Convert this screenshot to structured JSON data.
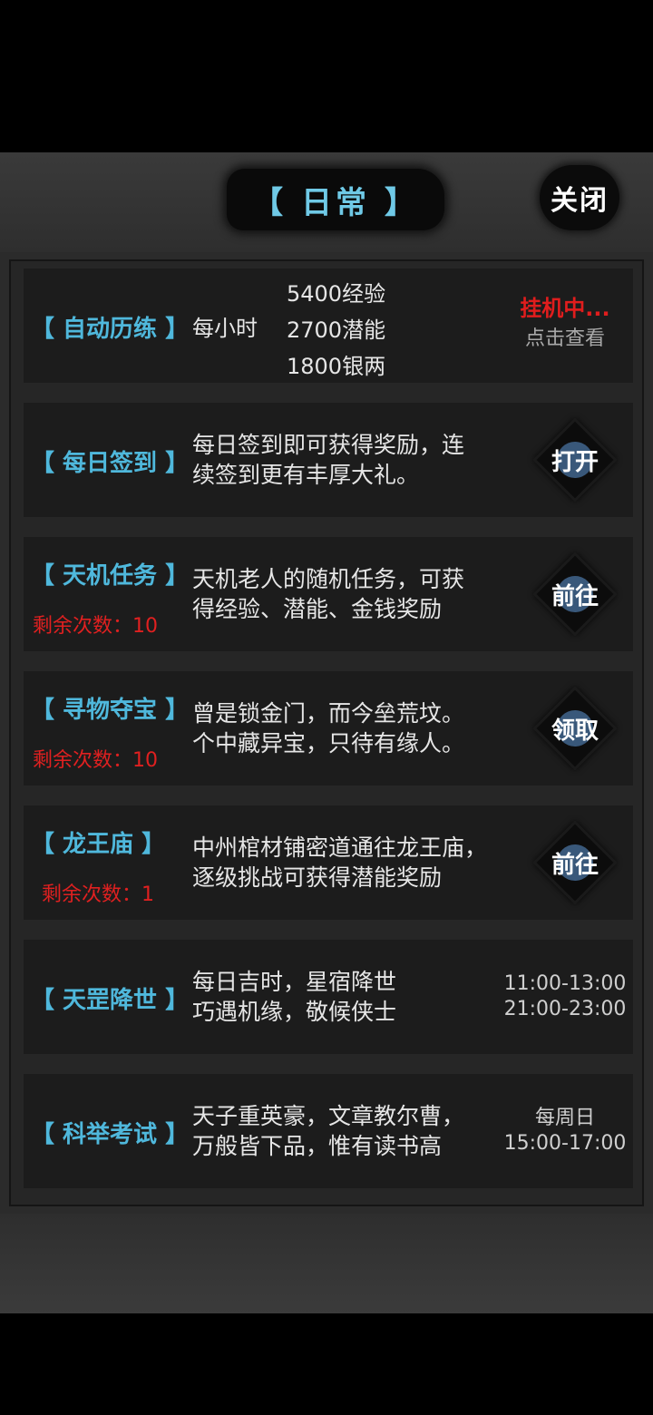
{
  "header": {
    "title": "【 日常 】",
    "close_label": "关闭"
  },
  "rows": [
    {
      "name": "【 自动历练 】",
      "per_label": "每小时",
      "stats": [
        "5400经验",
        "2700潜能",
        "1800银两"
      ],
      "status": "挂机中...",
      "status_action": "点击查看"
    },
    {
      "name": "【 每日签到 】",
      "desc_lines": [
        "每日签到即可获得奖励，连",
        "续签到更有丰厚大礼。"
      ],
      "button": "打开"
    },
    {
      "name": "【 天机任务 】",
      "remaining": "剩余次数：10",
      "desc_lines": [
        "天机老人的随机任务，可获",
        "得经验、潜能、金钱奖励"
      ],
      "button": "前往"
    },
    {
      "name": "【 寻物夺宝 】",
      "remaining": "剩余次数：10",
      "desc_lines": [
        "曾是锁金门，而今垒荒坟。",
        "个中藏异宝，只待有缘人。"
      ],
      "button": "领取"
    },
    {
      "name": "【 龙王庙 】",
      "remaining": "剩余次数：1",
      "desc_lines": [
        "中州棺材铺密道通往龙王庙，",
        "逐级挑战可获得潜能奖励"
      ],
      "button": "前往"
    },
    {
      "name": "【 天罡降世 】",
      "desc_lines": [
        "每日吉时，星宿降世",
        "巧遇机缘，敬候侠士"
      ],
      "times": [
        "11:00-13:00",
        "21:00-23:00"
      ]
    },
    {
      "name": "【 科举考试 】",
      "desc_lines": [
        "天子重英豪，文章教尔曹，",
        "万般皆下品，惟有读书高"
      ],
      "times": [
        "每周日",
        "15:00-17:00"
      ]
    }
  ],
  "colors": {
    "accent": "#4fb8dc",
    "warning": "#e02020",
    "button_inner": "#39587a"
  }
}
